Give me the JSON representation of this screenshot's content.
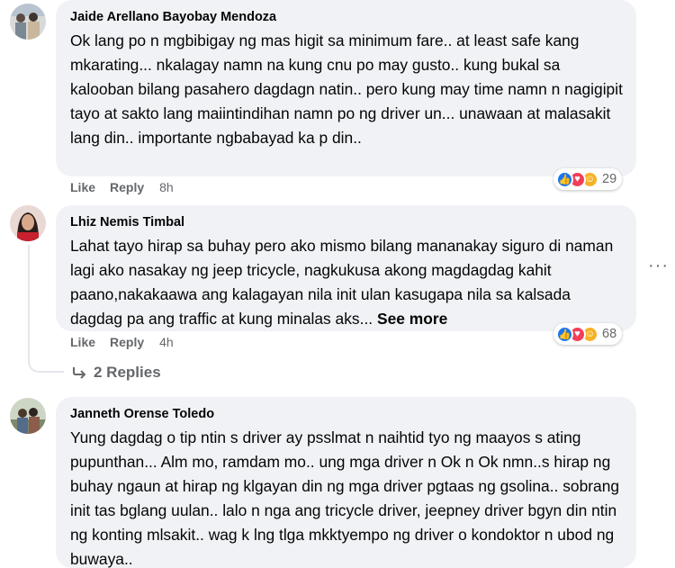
{
  "comments": [
    {
      "author": "Jaide Arellano Bayobay Mendoza",
      "text": "Ok lang po n mgbibigay ng mas higit sa minimum fare.. at least safe kang mkarating... nkalagay namn na kung cnu po may gusto.. kung bukal sa kalooban bilang pasahero dagdagn natin.. pero kung may time namn n nagigipit tayo at sakto lang maiintindihan namn po ng driver un... unawaan at malasakit lang din.. importante ngbabayad ka p din..",
      "like_label": "Like",
      "reply_label": "Reply",
      "time": "8h",
      "reaction_count": "29"
    },
    {
      "author": "Lhiz Nemis Timbal",
      "text": "Lahat tayo hirap sa buhay pero ako mismo bilang mananakay siguro di naman lagi ako nasakay ng jeep tricycle, nagkukusa akong magdagdag kahit paano,nakakaawa ang kalagayan nila init ulan kasugapa nila sa kalsada dagdag pa ang traffic at kung minalas aks...",
      "see_more": "See more",
      "like_label": "Like",
      "reply_label": "Reply",
      "time": "4h",
      "reaction_count": "68",
      "replies_label": "2 Replies"
    },
    {
      "author": "Janneth Orense Toledo",
      "text": "Yung dagdag o tip ntin s driver ay psslmat n naihtid tyo ng maayos s ating pupunthan... Alm mo, ramdam mo.. ung mga driver n Ok n Ok nmn..s hirap ng buhay ngaun at hirap ng klgayan din ng mga driver pgtaas ng gsolina.. sobrang init tas bglang uulan.. lalo n nga ang tricycle driver, jeepney driver bgyn din ntin ng konting mlsakit.. wag k lng tlga mkktyempo ng driver o kondoktor n ubod ng buwaya.."
    }
  ],
  "colors": {
    "bubble": "#f0f2f5",
    "secondary_text": "#65676b",
    "like_blue": "#1877f2",
    "love_red": "#f33e58",
    "care_yellow": "#f7b125"
  },
  "icons": [
    "like-reaction-icon",
    "love-reaction-icon",
    "care-reaction-icon",
    "more-options-icon",
    "reply-arrow-icon"
  ]
}
